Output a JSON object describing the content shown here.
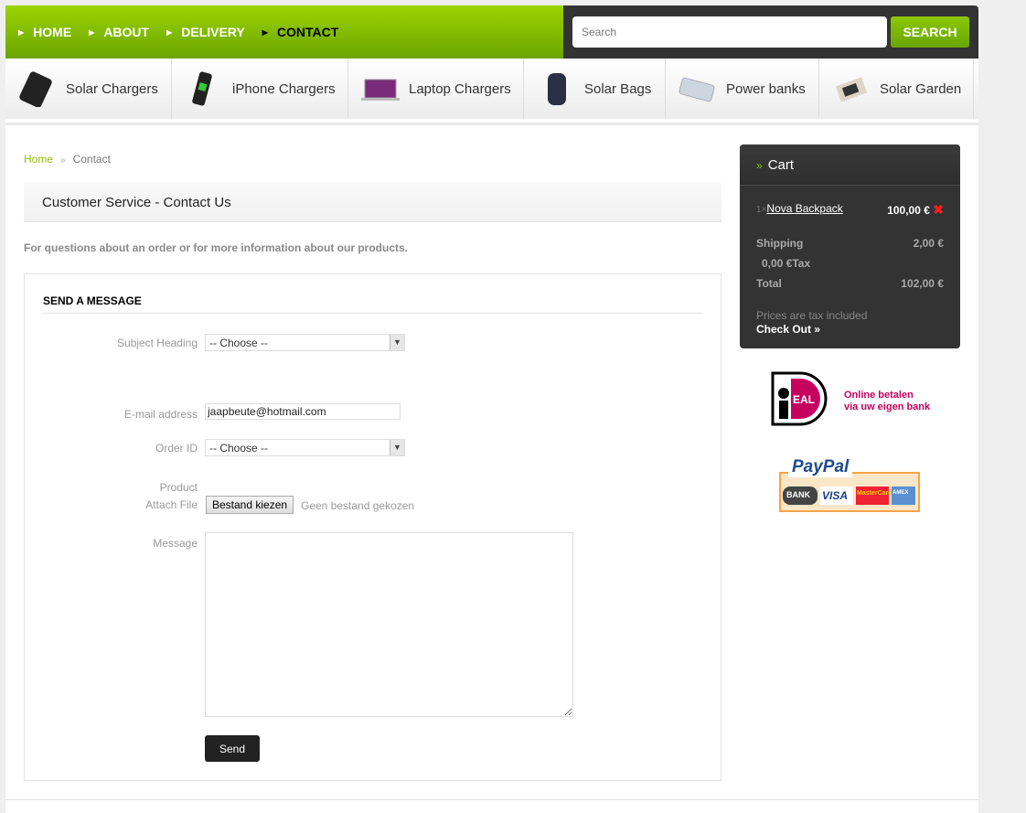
{
  "nav": {
    "items": [
      {
        "label": "HOME"
      },
      {
        "label": "ABOUT"
      },
      {
        "label": "DELIVERY"
      },
      {
        "label": "CONTACT"
      }
    ]
  },
  "search": {
    "placeholder": "Search",
    "button": "SEARCH"
  },
  "categories": [
    {
      "label": "Solar Chargers"
    },
    {
      "label": "iPhone Chargers"
    },
    {
      "label": "Laptop Chargers"
    },
    {
      "label": "Solar Bags"
    },
    {
      "label": "Power banks"
    },
    {
      "label": "Solar Garden"
    }
  ],
  "breadcrumb": {
    "home": "Home",
    "sep": "»",
    "current": "Contact"
  },
  "page_title": "Customer Service - Contact Us",
  "intro": "For questions about an order or for more information about our products.",
  "form": {
    "heading": "SEND A MESSAGE",
    "subject_label": "Subject Heading",
    "subject_value": "-- Choose --",
    "email_label": "E-mail address",
    "email_value": "jaapbeute@hotmail.com",
    "order_label": "Order ID",
    "order_value": "-- Choose --",
    "product_label": "Product",
    "attach_label": "Attach File",
    "file_button": "Bestand kiezen",
    "file_status": "Geen bestand gekozen",
    "message_label": "Message",
    "send": "Send"
  },
  "cart": {
    "title": "Cart",
    "item_qty": "1×",
    "item_name": "Nova Backpack",
    "item_price": "100,00 €",
    "shipping_label": "Shipping",
    "shipping_value": "2,00 €",
    "tax": "0,00 €Tax",
    "total_label": "Total",
    "total_value": "102,00 €",
    "note": "Prices are tax included",
    "checkout": "Check Out »"
  },
  "ideal": {
    "logo": "iDEAL",
    "text1": "Online betalen",
    "text2": "via uw eigen bank"
  },
  "paypal": {
    "logo": "PayPal",
    "cards": [
      "BANK",
      "VISA",
      "MasterCard",
      "AMEX"
    ]
  },
  "colors": {
    "accent": "#8cc000",
    "dark": "#333333",
    "ideal": "#c6005f"
  }
}
